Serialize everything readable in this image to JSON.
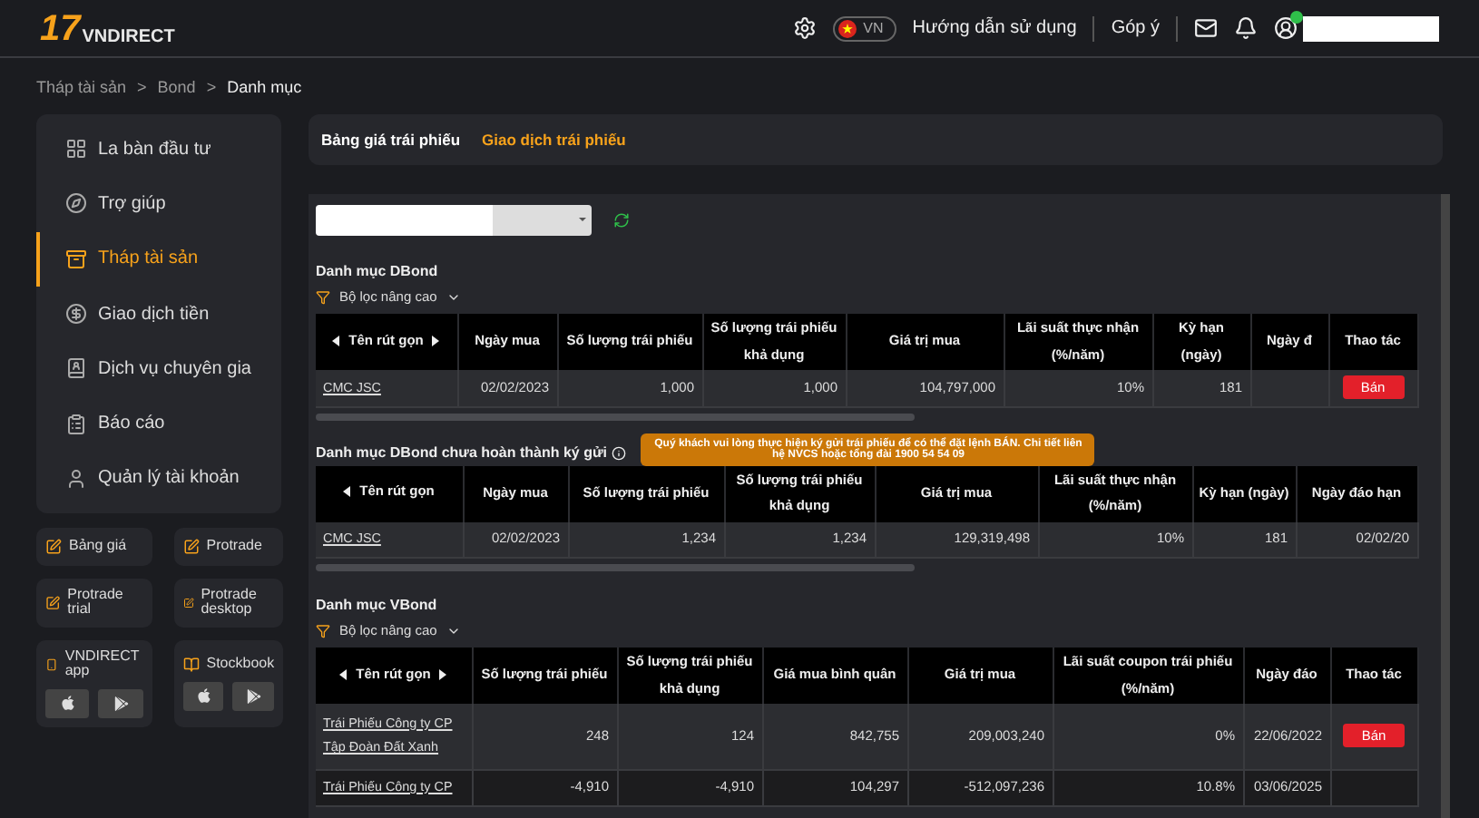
{
  "header": {
    "logo": {
      "number": "17",
      "name": "VNDIRECT"
    },
    "language": "VN",
    "links": [
      "Hướng dẫn sử dụng",
      "Góp ý"
    ],
    "notification_badge": true
  },
  "breadcrumb": {
    "items": [
      "Tháp tài sản",
      "Bond",
      "Danh mục"
    ],
    "separator": ">"
  },
  "sidebar": {
    "items": [
      {
        "label": "La bàn đầu tư",
        "selected": false
      },
      {
        "label": "Trợ giúp",
        "selected": false
      },
      {
        "label": "Tháp tài sản",
        "selected": true
      },
      {
        "label": "Giao dịch tiền",
        "selected": false
      },
      {
        "label": "Dịch vụ chuyên gia",
        "selected": false
      },
      {
        "label": "Báo cáo",
        "selected": false
      },
      {
        "label": "Quản lý tài khoản",
        "selected": false
      }
    ]
  },
  "quick_links": [
    {
      "label": "Bảng giá",
      "kind": "link"
    },
    {
      "label": "Protrade",
      "kind": "link"
    },
    {
      "label": "Protrade trial",
      "kind": "link"
    },
    {
      "label": "Protrade desktop",
      "kind": "link"
    },
    {
      "label": "VNDIRECT app",
      "kind": "app"
    },
    {
      "label": "Stockbook",
      "kind": "app"
    }
  ],
  "tabs": [
    {
      "label": "Bảng giá trái phiếu",
      "selected": false
    },
    {
      "label": "Giao dịch trái phiếu",
      "selected": true
    }
  ],
  "sections": [
    {
      "title": "Danh mục DBond",
      "filter": "Bộ lọc nâng cao",
      "columns": [
        "Tên rút gọn",
        "Ngày mua",
        "Số lượng trái phiếu",
        "Số lượng trái phiếu khả dụng",
        "Giá trị mua",
        "Lãi suất thực nhận (%/năm)",
        "Kỳ hạn (ngày)",
        "Ngày đ",
        "Thao tác"
      ],
      "rows": [
        {
          "cells": [
            "CMC JSC",
            "02/02/2023",
            "1,000",
            "1,000",
            "104,797,000",
            "10%",
            "181",
            ""
          ],
          "action": "Bán"
        }
      ]
    },
    {
      "title": "Danh mục DBond chưa hoàn thành ký gửi",
      "info": true,
      "tooltip": "Quý khách vui lòng thực hiện ký gửi trái phiếu để có thể đặt lệnh BÁN. Chi tiết liên hệ NVCS hoặc tổng đài 1900 54 54 09",
      "columns": [
        "Tên rút gọn",
        "Ngày mua",
        "Số lượng trái phiếu",
        "Số lượng trái phiếu khả dụng",
        "Giá trị mua",
        "Lãi suất thực nhận (%/năm)",
        "Kỳ hạn (ngày)",
        "Ngày đáo hạn"
      ],
      "rows": [
        {
          "cells": [
            "CMC JSC",
            "02/02/2023",
            "1,234",
            "1,234",
            "129,319,498",
            "10%",
            "181",
            "02/02/20"
          ]
        }
      ]
    },
    {
      "title": "Danh mục VBond",
      "filter": "Bộ lọc nâng cao",
      "columns": [
        "Tên rút gọn",
        "Số lượng trái phiếu",
        "Số lượng trái phiếu khả dụng",
        "Giá mua bình quân",
        "Giá trị mua",
        "Lãi suất coupon trái phiếu (%/năm)",
        "Ngày đáo",
        "Thao tác"
      ],
      "rows": [
        {
          "cells": [
            "Trái Phiếu Công ty CP\nTập Đoàn Đất Xanh",
            "248",
            "124",
            "842,755",
            "209,003,240",
            "0%",
            "22/06/2022"
          ],
          "action": "Bán"
        },
        {
          "cells": [
            "Trái Phiếu Công ty CP",
            "-4,910",
            "-4,910",
            "104,297",
            "-512,097,236",
            "10.8%",
            "03/06/2025"
          ]
        }
      ]
    }
  ]
}
